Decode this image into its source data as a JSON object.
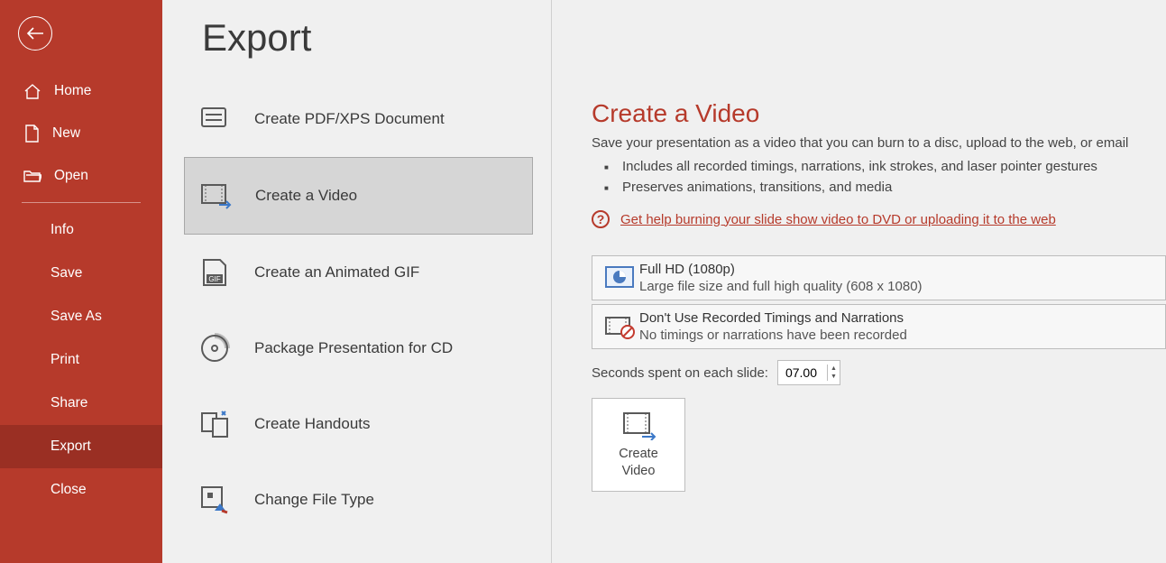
{
  "sidebar": {
    "primary": [
      {
        "label": "Home",
        "icon": "home-icon"
      },
      {
        "label": "New",
        "icon": "new-icon"
      },
      {
        "label": "Open",
        "icon": "open-icon"
      }
    ],
    "secondary": [
      {
        "label": "Info"
      },
      {
        "label": "Save"
      },
      {
        "label": "Save As"
      },
      {
        "label": "Print"
      },
      {
        "label": "Share"
      },
      {
        "label": "Export",
        "selected": true
      },
      {
        "label": "Close"
      }
    ]
  },
  "page": {
    "title": "Export"
  },
  "export_options": [
    {
      "label": "Create PDF/XPS Document",
      "icon": "pdf-icon"
    },
    {
      "label": "Create a Video",
      "icon": "video-icon",
      "selected": true
    },
    {
      "label": "Create an Animated GIF",
      "icon": "gif-icon"
    },
    {
      "label": "Package Presentation for CD",
      "icon": "cd-icon"
    },
    {
      "label": "Create Handouts",
      "icon": "handouts-icon"
    },
    {
      "label": "Change File Type",
      "icon": "file-type-icon"
    }
  ],
  "detail": {
    "title": "Create a Video",
    "subtitle": "Save your presentation as a video that you can burn to a disc, upload to the web, or email",
    "bullets": [
      "Includes all recorded timings, narrations, ink strokes, and laser pointer gestures",
      "Preserves animations, transitions, and media"
    ],
    "help_link": "Get help burning your slide show video to DVD or uploading it to the web",
    "resolution": {
      "main": "Full HD (1080p)",
      "sub": "Large file size and full high quality (608 x 1080)"
    },
    "timings": {
      "main": "Don't Use Recorded Timings and Narrations",
      "sub": "No timings or narrations have been recorded"
    },
    "seconds_label": "Seconds spent on each slide:",
    "seconds_value": "07.00",
    "create_button": "Create\nVideo"
  }
}
